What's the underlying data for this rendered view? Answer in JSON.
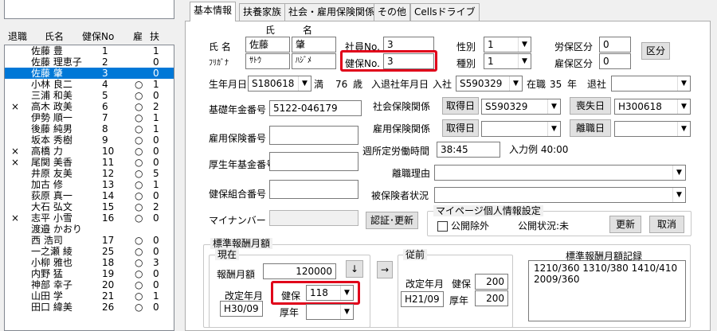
{
  "left_panel": {
    "headers": {
      "retire": "退職",
      "name": "氏名",
      "kenpo_no": "健保No",
      "employ": "雇",
      "depend": "扶"
    },
    "rows": [
      {
        "mark": "",
        "name": "佐藤 豊",
        "no": "1",
        "employ": "",
        "dep": "1"
      },
      {
        "mark": "",
        "name": "佐藤 理恵子",
        "no": "2",
        "employ": "",
        "dep": "0"
      },
      {
        "mark": "",
        "name": "佐藤 肇",
        "no": "3",
        "employ": "",
        "dep": "0"
      },
      {
        "mark": "",
        "name": "小林 良二",
        "no": "4",
        "employ": "○",
        "dep": "1"
      },
      {
        "mark": "",
        "name": "三浦 和美",
        "no": "5",
        "employ": "○",
        "dep": "0"
      },
      {
        "mark": "×",
        "name": "高木 政美",
        "no": "6",
        "employ": "○",
        "dep": "2"
      },
      {
        "mark": "",
        "name": "伊勢 順一",
        "no": "7",
        "employ": "○",
        "dep": "1"
      },
      {
        "mark": "",
        "name": "後藤 純男",
        "no": "8",
        "employ": "○",
        "dep": "1"
      },
      {
        "mark": "",
        "name": "坂本 秀樹",
        "no": "9",
        "employ": "○",
        "dep": "0"
      },
      {
        "mark": "×",
        "name": "高橋 力",
        "no": "10",
        "employ": "○",
        "dep": "0"
      },
      {
        "mark": "×",
        "name": "尾関 美香",
        "no": "11",
        "employ": "○",
        "dep": "0"
      },
      {
        "mark": "",
        "name": "井原 友美",
        "no": "12",
        "employ": "○",
        "dep": "5"
      },
      {
        "mark": "",
        "name": "加古 修",
        "no": "13",
        "employ": "○",
        "dep": "1"
      },
      {
        "mark": "",
        "name": "荻原 真一",
        "no": "14",
        "employ": "○",
        "dep": "0"
      },
      {
        "mark": "",
        "name": "大石 弘文",
        "no": "15",
        "employ": "○",
        "dep": "2"
      },
      {
        "mark": "×",
        "name": "志平 小雪",
        "no": "16",
        "employ": "○",
        "dep": "0"
      },
      {
        "mark": "",
        "name": "渡邉 かおり",
        "no": "",
        "employ": "",
        "dep": ""
      },
      {
        "mark": "",
        "name": "西 浩司",
        "no": "17",
        "employ": "○",
        "dep": "0"
      },
      {
        "mark": "",
        "name": "一之瀬 綾",
        "no": "25",
        "employ": "○",
        "dep": "0"
      },
      {
        "mark": "",
        "name": "小柳 雅也",
        "no": "18",
        "employ": "○",
        "dep": "3"
      },
      {
        "mark": "",
        "name": "内野 猛",
        "no": "19",
        "employ": "○",
        "dep": "0"
      },
      {
        "mark": "",
        "name": "神部 幸子",
        "no": "20",
        "employ": "○",
        "dep": "0"
      },
      {
        "mark": "",
        "name": "山田 学",
        "no": "21",
        "employ": "○",
        "dep": "1"
      },
      {
        "mark": "",
        "name": "田口 緯美",
        "no": "26",
        "employ": "○",
        "dep": "0"
      }
    ]
  },
  "tabs": [
    "基本情報",
    "扶養家族",
    "社会・雇用保険関係",
    "その他",
    "Cellsドライブ"
  ],
  "form": {
    "shi": "氏",
    "mei": "名",
    "name_label": "氏 名",
    "kana_label": "ﾌﾘｶﾞﾅ",
    "last_name": "佐藤",
    "first_name": "肇",
    "last_kana": "ｻﾄｳ",
    "first_kana": "ﾊｼﾞﾒ",
    "emp_no_label": "社員No.",
    "emp_no": "3",
    "kenpo_no_label": "健保No.",
    "kenpo_no": "3",
    "gender_label": "性別",
    "gender": "1",
    "type_label": "種別",
    "type": "1",
    "rouho_label": "労保区分",
    "rouho": "0",
    "koyo_label": "雇保区分",
    "koyo": "0",
    "kubun_button": "区分",
    "birth_label": "生年月日",
    "birth": "S180618",
    "age_mark": "満",
    "age": "76",
    "age_unit": "歳",
    "ent_label": "入退社年月日",
    "ent_in": "入社",
    "ent_date": "S590329",
    "tenure_label": "在職",
    "tenure": "35",
    "tenure_unit": "年",
    "exit_label": "退社",
    "exit_date": "",
    "pension_label": "基礎年金番号",
    "pension_no": "5122-046179",
    "social_label": "社会保険関係",
    "get_date_btn": "取得日",
    "social_get": "S590329",
    "lost_btn": "喪失日",
    "social_lost": "H300618",
    "emp_ins_label": "雇用保険関係",
    "emp_get_btn": "取得日",
    "emp_get": "",
    "emp_lost_btn": "離職日",
    "emp_lost": "",
    "koyo_no_label": "雇用保険番号",
    "koyo_no": "",
    "hours_label": "週所定労働時間",
    "hours": "38:45",
    "hours_example": "入力例 40:00",
    "kosei_label": "厚生年基金番号",
    "kosei_no": "",
    "reason_label": "離職理由",
    "reason": "",
    "kumiai_label": "健保組合番号",
    "kumiai_no": "",
    "insured_label": "被保険者状況",
    "insured": "",
    "mynumber_label": "マイナンバー",
    "mynumber": "",
    "auth_button": "認証･更新",
    "mypage": {
      "title": "マイページ個人情報設定",
      "exclude": "公開除外",
      "status": "公開状況:未",
      "update": "更新",
      "cancel": "取消"
    }
  },
  "salary": {
    "group": "標準報酬月額",
    "current": "現在",
    "monthly_label": "報酬月額",
    "monthly": "120000",
    "down_arrow": "↓",
    "right_arrow": "→",
    "revised_label": "改定年月",
    "revised": "H30/09",
    "kenpo_label": "健保",
    "kenpo_grade": "118",
    "kosei_label": "厚年",
    "kosei_grade": "",
    "prev": "従前",
    "prev_revised_label": "改定年月",
    "prev_revised": "H21/09",
    "prev_kenpo_label": "健保",
    "prev_kenpo": "200",
    "prev_kosei_label": "厚年",
    "prev_kosei": "200",
    "record_title": "標準報酬月額記録",
    "record_line1": "1210/360 1310/380 1410/410",
    "record_line2": "2009/360"
  }
}
